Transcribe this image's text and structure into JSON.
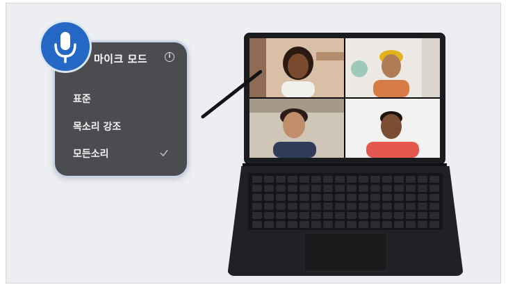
{
  "mic_mode": {
    "title": "마이크 모드",
    "info_icon": "ⓘ",
    "options": [
      {
        "label": "표준",
        "selected": false
      },
      {
        "label": "목소리 강조",
        "selected": false
      },
      {
        "label": "모든소리",
        "selected": true
      }
    ]
  },
  "icons": {
    "badge": "microphone-icon",
    "info": "info-icon",
    "selected": "check-icon"
  },
  "colors": {
    "badge": "#2567c4",
    "panel": "#4a4c50",
    "background": "#eceef1"
  }
}
